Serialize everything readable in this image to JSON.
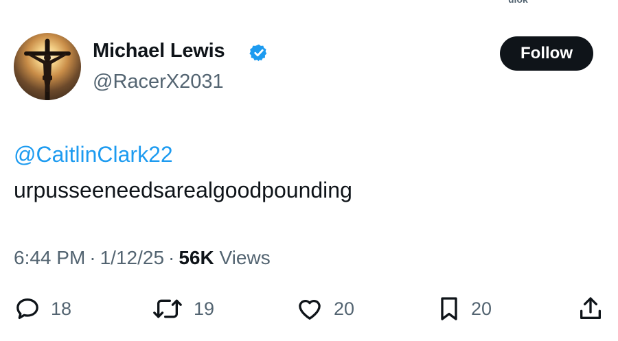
{
  "header": {
    "top_cut_text": "ulok"
  },
  "author": {
    "name": "Michael Lewis",
    "handle": "@RacerX2031",
    "verified": true,
    "avatar_icon": "crucifix-avatar"
  },
  "follow_button": {
    "label": "Follow"
  },
  "tweet": {
    "mention": "@CaitlinClark22",
    "text": "urpusseeneedsarealgoodpounding"
  },
  "meta": {
    "time": "6:44 PM",
    "date": "1/12/25",
    "views_count": "56K",
    "views_label": "Views",
    "separator": "·"
  },
  "actions": {
    "replies": "18",
    "reposts": "19",
    "likes": "20",
    "bookmarks": "20"
  },
  "colors": {
    "accent": "#1d9bf0",
    "text": "#0f1419",
    "muted": "#536471",
    "button_bg": "#0f1419"
  }
}
